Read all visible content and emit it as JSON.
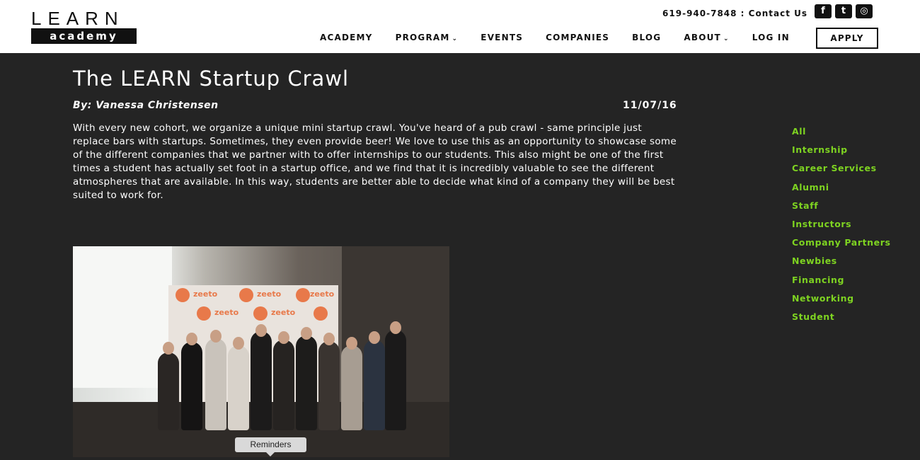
{
  "header": {
    "logo_top": "LEARN",
    "logo_bottom": "academy",
    "contact": "619-940-7848 : Contact Us",
    "social": [
      {
        "icon": "facebook-icon",
        "glyph": "f"
      },
      {
        "icon": "twitter-icon",
        "glyph": "t"
      },
      {
        "icon": "instagram-icon",
        "glyph": "◎"
      }
    ],
    "nav": [
      {
        "label": "ACADEMY",
        "dropdown": false
      },
      {
        "label": "PROGRAM",
        "dropdown": true
      },
      {
        "label": "EVENTS",
        "dropdown": false
      },
      {
        "label": "COMPANIES",
        "dropdown": false
      },
      {
        "label": "BLOG",
        "dropdown": false
      },
      {
        "label": "ABOUT",
        "dropdown": true
      },
      {
        "label": "LOG IN",
        "dropdown": false
      }
    ],
    "apply_label": "APPLY"
  },
  "article": {
    "title": "The LEARN Startup Crawl",
    "byline": "By: Vanessa Christensen",
    "date": "11/07/16",
    "body": "With every new cohort, we organize a unique mini startup crawl. You've heard of a pub crawl - same principle just replace bars with startups. Sometimes, they even provide beer! We love to use this as an opportunity to showcase some of the different companies that we partner with to offer internships to our students. This also might be one of the first times a student has actually set foot in a startup office, and we find that it is incredibly valuable to see the different atmospheres that are available. In this way, students are better able to decide what kind of a company they will be best suited to work for.",
    "photo_banner_word": "zeeto",
    "tooltip": "Reminders"
  },
  "sidebar": {
    "categories": [
      "All",
      "Internship",
      "Career Services",
      "Alumni",
      "Staff",
      "Instructors",
      "Company Partners",
      "Newbies",
      "Financing",
      "Networking",
      "Student"
    ]
  },
  "colors": {
    "background": "#242424",
    "header": "#ffffff",
    "accent_green": "#7ed321"
  }
}
